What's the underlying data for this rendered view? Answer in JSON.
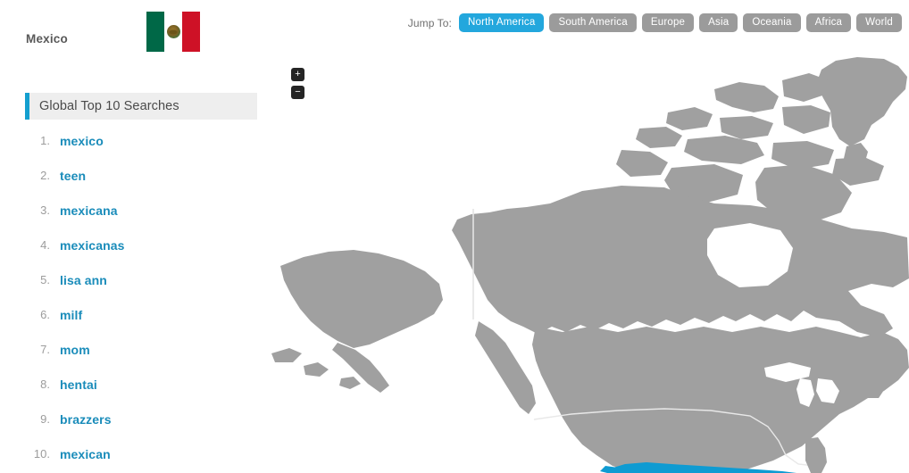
{
  "country": {
    "name": "Mexico",
    "flag_icon": "mexico-flag-icon",
    "flag_colors": {
      "green": "#006847",
      "white": "#ffffff",
      "red": "#ce1126"
    }
  },
  "jump_nav": {
    "label": "Jump To:",
    "items": [
      {
        "label": "North America",
        "active": true
      },
      {
        "label": "South America",
        "active": false
      },
      {
        "label": "Europe",
        "active": false
      },
      {
        "label": "Asia",
        "active": false
      },
      {
        "label": "Oceania",
        "active": false
      },
      {
        "label": "Africa",
        "active": false
      },
      {
        "label": "World",
        "active": false
      }
    ]
  },
  "panel": {
    "section_title": "Global Top 10 Searches",
    "accent_color": "#149fcf",
    "items": [
      {
        "rank": "1.",
        "term": "mexico"
      },
      {
        "rank": "2.",
        "term": "teen"
      },
      {
        "rank": "3.",
        "term": "mexicana"
      },
      {
        "rank": "4.",
        "term": "mexicanas"
      },
      {
        "rank": "5.",
        "term": "lisa ann"
      },
      {
        "rank": "6.",
        "term": "milf"
      },
      {
        "rank": "7.",
        "term": "mom"
      },
      {
        "rank": "8.",
        "term": "hentai"
      },
      {
        "rank": "9.",
        "term": "brazzers"
      },
      {
        "rank": "10.",
        "term": "mexican"
      }
    ]
  },
  "map": {
    "region": "North America",
    "land_color": "#a0a0a0",
    "highlight_color": "#0f9bd2",
    "border_color": "#ffffff",
    "ocean_color": "#ffffff",
    "highlighted_country": "Mexico",
    "zoom_in_label": "+",
    "zoom_out_label": "−"
  }
}
